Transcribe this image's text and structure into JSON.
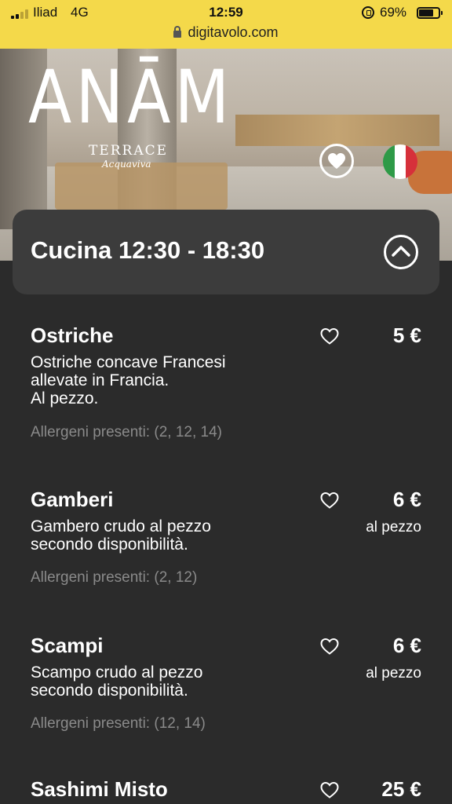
{
  "status_bar": {
    "carrier": "Iliad",
    "network": "4G",
    "time": "12:59",
    "battery": "69%",
    "battery_level": 0.69,
    "url": "digitavolo.com"
  },
  "hero": {
    "logo_main": "ANĀM",
    "logo_sub": "TERRACE",
    "logo_script": "Acquaviva",
    "favorite_icon": "heart-icon",
    "language_flag": "italian-flag-icon"
  },
  "category": {
    "title": "Cucina 12:30 - 18:30",
    "toggle_icon": "chevron-up-icon"
  },
  "items": [
    {
      "name": "Ostriche",
      "price": "5 €",
      "unit": "",
      "description": "Ostriche concave Francesi\nallevate in Francia.\nAl pezzo.",
      "allergens": "Allergeni presenti: (2, 12, 14)"
    },
    {
      "name": "Gamberi",
      "price": "6 €",
      "unit": "al pezzo",
      "description": "Gambero crudo al pezzo\nsecondo disponibilità.",
      "allergens": "Allergeni presenti: (2, 12)"
    },
    {
      "name": "Scampi",
      "price": "6 €",
      "unit": "al pezzo",
      "description": "Scampo crudo al pezzo\nsecondo disponibilità.",
      "allergens": "Allergeni presenti: (12, 14)"
    },
    {
      "name": "Sashimi Misto",
      "price": "25 €",
      "unit": "",
      "description": "",
      "allergens": ""
    }
  ],
  "colors": {
    "status_bar_bg": "#f4d94a",
    "page_bg": "#2b2b2b",
    "category_bg": "#3c3c3c",
    "allergen_text": "#8a8a8a",
    "flag_green": "#2e9a47",
    "flag_white": "#ffffff",
    "flag_red": "#d6303a"
  }
}
